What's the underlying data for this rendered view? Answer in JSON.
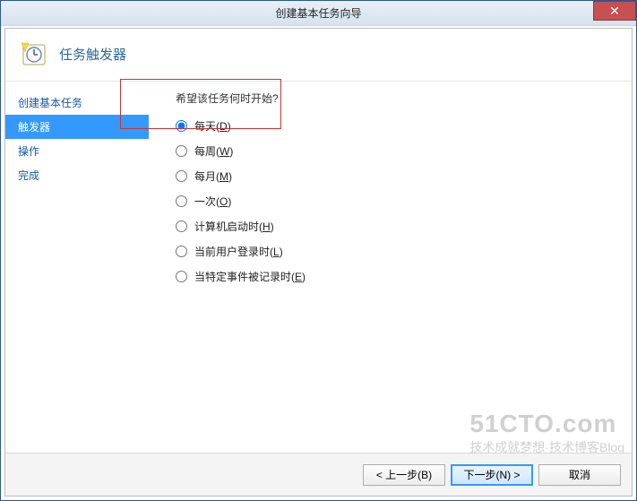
{
  "window": {
    "title": "创建基本任务向导",
    "close": "✕"
  },
  "page_title": "任务触发器",
  "sidebar": {
    "items": [
      {
        "label": "创建基本任务",
        "active": false
      },
      {
        "label": "触发器",
        "active": true
      },
      {
        "label": "操作",
        "active": false
      },
      {
        "label": "完成",
        "active": false
      }
    ]
  },
  "main": {
    "prompt": "希望该任务何时开始?",
    "options": [
      {
        "label": "每天",
        "accel": "D",
        "checked": true
      },
      {
        "label": "每周",
        "accel": "W",
        "checked": false
      },
      {
        "label": "每月",
        "accel": "M",
        "checked": false
      },
      {
        "label": "一次",
        "accel": "O",
        "checked": false
      },
      {
        "label": "计算机启动时",
        "accel": "H",
        "checked": false
      },
      {
        "label": "当前用户登录时",
        "accel": "L",
        "checked": false
      },
      {
        "label": "当特定事件被记录时",
        "accel": "E",
        "checked": false
      }
    ]
  },
  "footer": {
    "back": "< 上一步(B)",
    "next": "下一步(N) >",
    "cancel": "取消"
  },
  "watermark": {
    "main": "51CTO.com",
    "sub": "技术成就梦想·技术博客Blog"
  }
}
